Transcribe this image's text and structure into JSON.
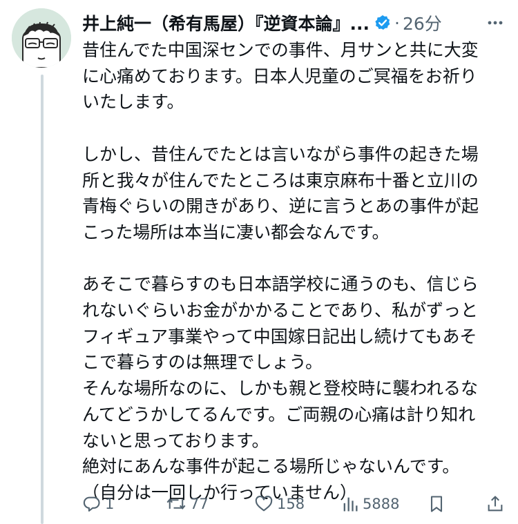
{
  "author": {
    "display_name": "井上純一（希有馬屋）『逆資本論』...",
    "verified": true
  },
  "meta": {
    "separator": "·",
    "time": "26分"
  },
  "tweet": {
    "text": "昔住んでた中国深センでの事件、月サンと共に大変\nに心痛めております。日本人児童のご冥福をお祈り\nいたします。\n\nしかし、昔住んでたとは言いながら事件の起きた場\n所と我々が住んでたところは東京麻布十番と立川の\n青梅ぐらいの開きがあり、逆に言うとあの事件が起\nこった場所は本当に凄い都会なんです。\n\nあそこで暮らすのも日本語学校に通うのも、信じら\nれないぐらいお金がかかることであり、私がずっと\nフィギュア事業やって中国嫁日記出し続けてもあそ\nこで暮らすのは無理でしょう。\nそんな場所なのに、しかも親と登校時に襲われるな\nんてどうかしてるんです。ご両親の心痛は計り知れ\nないと思っております。\n絶対にあんな事件が起こる場所じゃないんです。\n（自分は一回しか行っていません）"
  },
  "actions": {
    "reply": "1",
    "retweet": "77",
    "like": "158",
    "views": "5888"
  },
  "icons": {
    "verified": "verified-badge-icon",
    "more": "more-options-icon",
    "reply": "reply-icon",
    "retweet": "retweet-icon",
    "like": "heart-icon",
    "views": "views-chart-icon",
    "bookmark": "bookmark-icon",
    "share": "share-icon"
  },
  "colors": {
    "text": "#0f1419",
    "secondary": "#536471",
    "verified": "#1d9bf0",
    "thread_line": "#cfd9de",
    "avatar_bg": "#d6e7de"
  }
}
